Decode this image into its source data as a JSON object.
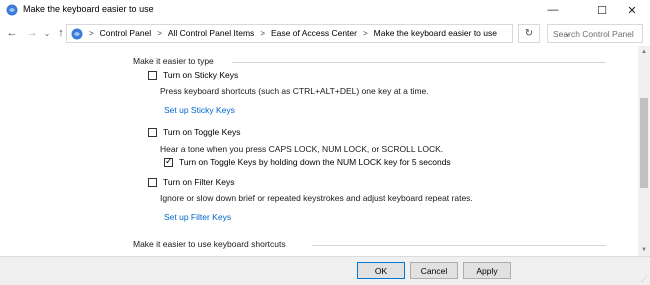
{
  "window": {
    "title": "Make the keyboard easier to use",
    "minimize_glyph": "—",
    "maximize_glyph": "☐",
    "close_glyph": "✕"
  },
  "nav": {
    "back_glyph": "←",
    "forward_glyph": "→",
    "recent_glyph": "⌄",
    "up_glyph": "↑",
    "breadcrumbs": [
      "Control Panel",
      "All Control Panel Items",
      "Ease of Access Center",
      "Make the keyboard easier to use"
    ],
    "separator": ">",
    "dropdown_glyph": "⌄",
    "refresh_glyph": "↻",
    "search_placeholder": "Search Control Panel"
  },
  "main": {
    "section_type": "Make it easier to type",
    "sticky": {
      "label": "Turn on Sticky Keys",
      "checked": false,
      "description": "Press keyboard shortcuts (such as CTRL+ALT+DEL) one key at a time.",
      "link": "Set up Sticky Keys"
    },
    "toggle": {
      "label": "Turn on Toggle Keys",
      "checked": false,
      "description": "Hear a tone when you press CAPS LOCK, NUM LOCK, or SCROLL LOCK.",
      "sub_label": "Turn on Toggle Keys by holding down the NUM LOCK key for 5 seconds",
      "sub_checked": true
    },
    "filter": {
      "label": "Turn on Filter Keys",
      "checked": false,
      "description": "Ignore or slow down brief or repeated keystrokes and adjust keyboard repeat rates.",
      "link": "Set up Filter Keys"
    },
    "section_shortcuts": "Make it easier to use keyboard shortcuts"
  },
  "footer": {
    "ok": "OK",
    "cancel": "Cancel",
    "apply": "Apply"
  },
  "colors": {
    "link": "#0066cc",
    "accent_border": "#0078d7"
  }
}
